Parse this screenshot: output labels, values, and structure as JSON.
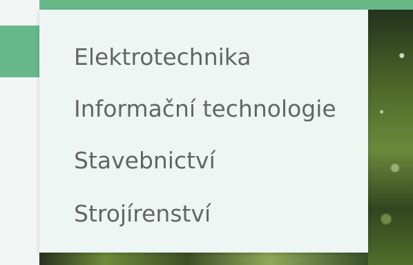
{
  "menu": {
    "items": [
      {
        "label": "Elektrotechnika"
      },
      {
        "label": "Informační technologie"
      },
      {
        "label": "Stavebnictví"
      },
      {
        "label": "Strojírenství"
      }
    ]
  },
  "colors": {
    "accent": "#67b98a",
    "dropdown_background": "#eef6f4",
    "text": "#646464",
    "page_background": "#f4f6f5"
  }
}
